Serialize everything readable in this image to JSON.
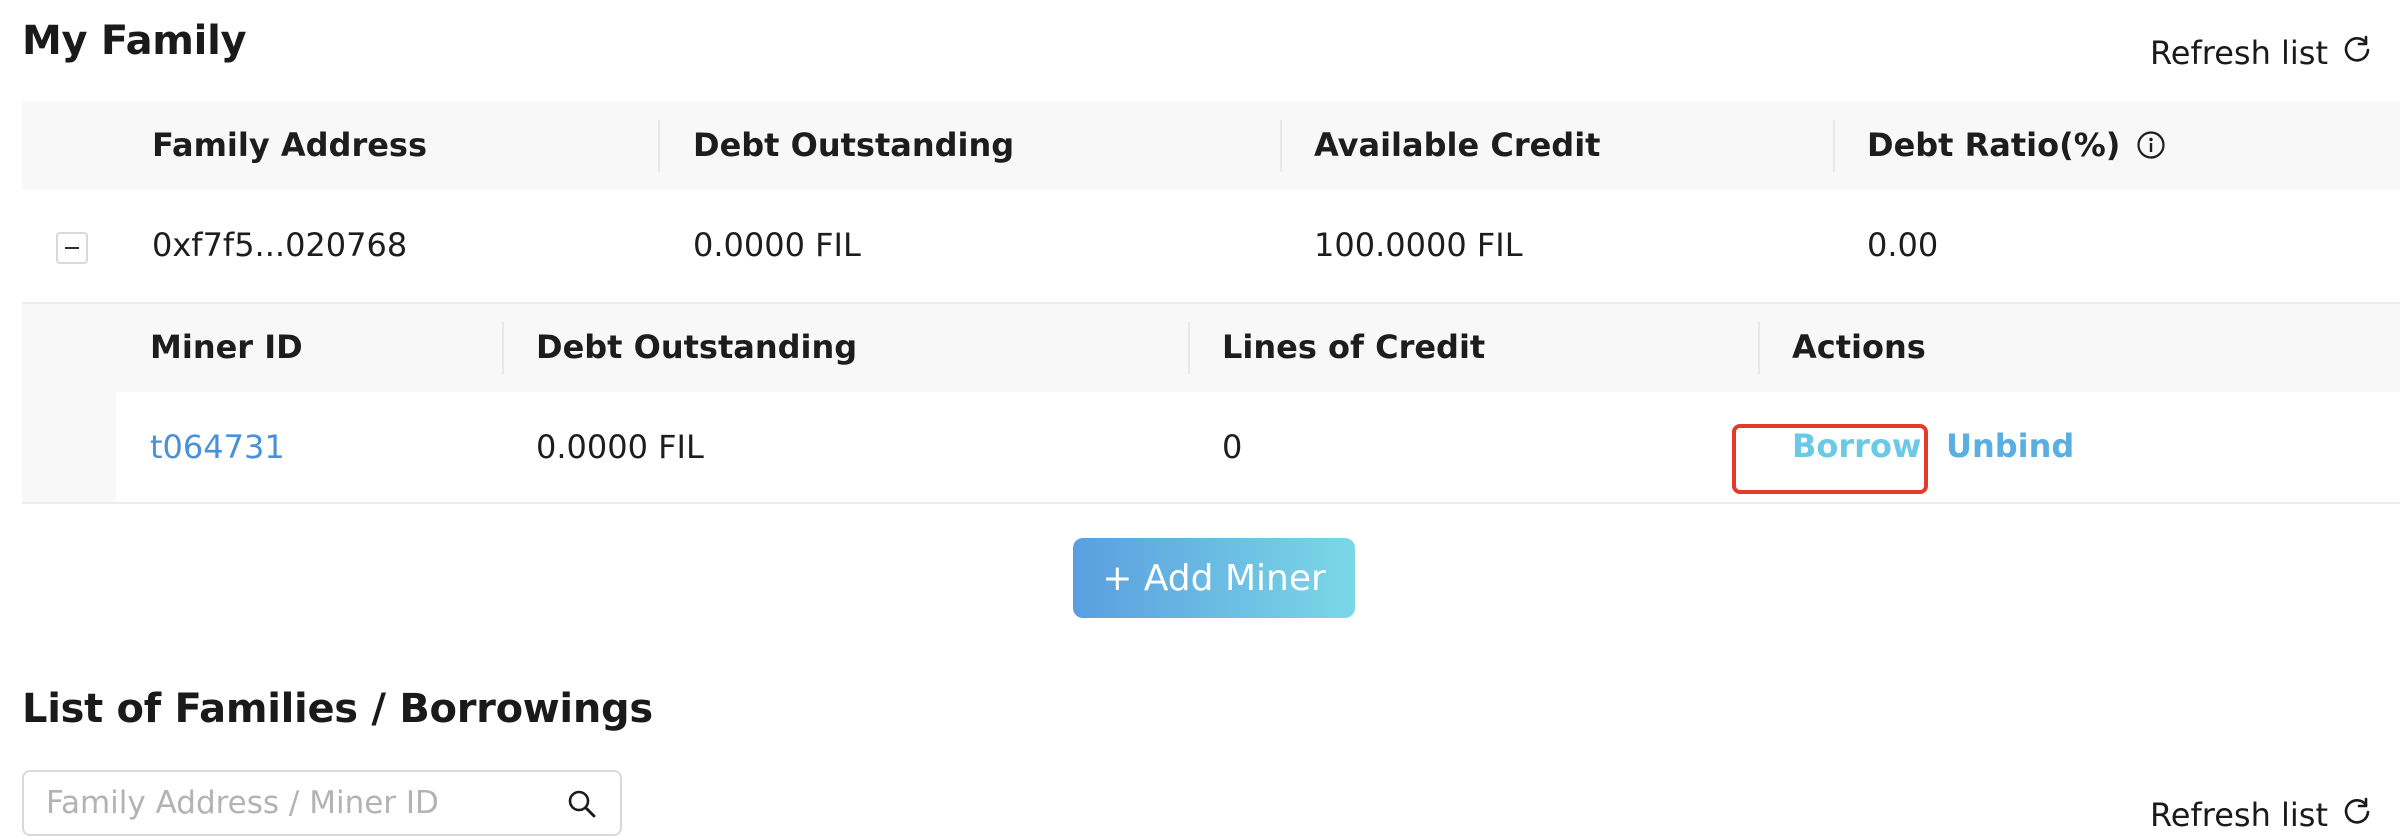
{
  "my_family": {
    "title": "My Family",
    "refresh_label": "Refresh list",
    "table": {
      "headers": {
        "family_address": "Family Address",
        "debt_outstanding": "Debt Outstanding",
        "available_credit": "Available Credit",
        "debt_ratio": "Debt Ratio(%)"
      },
      "row": {
        "family_address": "0xf7f5...020768",
        "debt_outstanding": "0.0000 FIL",
        "available_credit": "100.0000 FIL",
        "debt_ratio": "0.00"
      },
      "sub_table": {
        "headers": {
          "miner_id": "Miner ID",
          "debt_outstanding": "Debt Outstanding",
          "lines_of_credit": "Lines of Credit",
          "actions": "Actions"
        },
        "row": {
          "miner_id": "t064731",
          "debt_outstanding": "0.0000 FIL",
          "lines_of_credit": "0",
          "borrow_label": "Borrow",
          "unbind_label": "Unbind"
        }
      }
    },
    "add_miner_label": "+ Add Miner"
  },
  "families_list": {
    "title": "List of Families / Borrowings",
    "search": {
      "placeholder": "Family Address / Miner ID",
      "value": ""
    },
    "refresh_label": "Refresh list"
  },
  "colors": {
    "link": "#4a90d9",
    "borrow": "#6cc9e6",
    "unbind": "#5aaee0",
    "button_gradient_start": "#5a9ee0",
    "button_gradient_end": "#7ad8e6",
    "highlight": "#e5392b"
  },
  "icons": {
    "refresh": "refresh-icon",
    "info": "info-icon",
    "search": "search-icon",
    "collapse": "minus-square-icon"
  }
}
